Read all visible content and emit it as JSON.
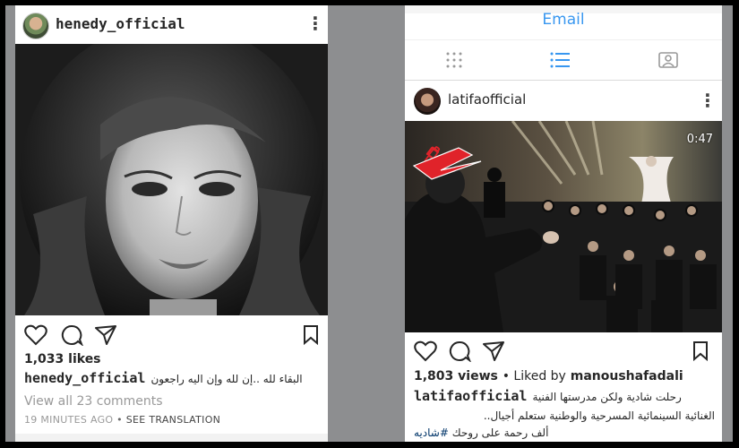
{
  "left_post": {
    "username": "henedy_official",
    "likes": "1,033 likes",
    "caption_user": "henedy_official",
    "caption_text": "البقاء لله ..إن لله وإن اليه راجعون",
    "comments_link": "View all 23 comments",
    "time": "19 MINUTES AGO",
    "separator": "•",
    "translation": "SEE TRANSLATION"
  },
  "right_post": {
    "tab_title": "Email",
    "username": "latifaofficial",
    "video_duration": "0:47",
    "views": "1,803 views",
    "liked_by_prefix": "• Liked by",
    "liked_by_user": "manoushafadali",
    "caption_user": "latifaofficial",
    "caption_line1": "رحلت شادية ولكن مدرستها الفنية",
    "caption_line2": "الغنائية السينمائية المسرحية والوطنية ستعلم أجيال..",
    "caption_line3": "ألف رحمة على روحك",
    "hashtag": "#شاديه"
  },
  "icons": {
    "heart": "heart-icon",
    "comment": "comment-icon",
    "share": "share-icon",
    "save": "bookmark-icon",
    "more": "more-options-icon"
  }
}
